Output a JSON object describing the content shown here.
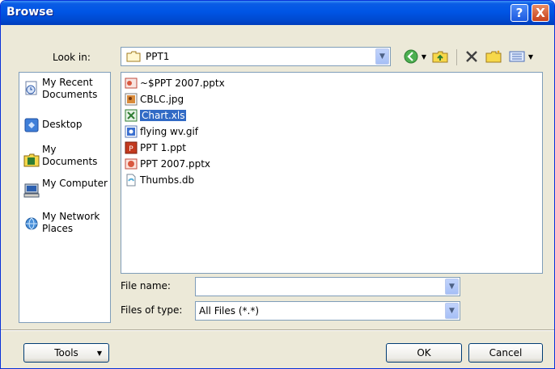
{
  "window": {
    "title": "Browse",
    "help_label": "?",
    "close_label": "X"
  },
  "look_in": {
    "label": "Look in:",
    "value": "PPT1"
  },
  "places": [
    {
      "label": "My Recent Documents",
      "icon": "recent-documents-icon"
    },
    {
      "label": "Desktop",
      "icon": "desktop-icon"
    },
    {
      "label": "My Documents",
      "icon": "my-documents-icon"
    },
    {
      "label": "My Computer",
      "icon": "my-computer-icon"
    },
    {
      "label": "My Network Places",
      "icon": "network-places-icon"
    }
  ],
  "files": [
    {
      "name": "~$PPT 2007.pptx",
      "icon": "pptx-file-icon",
      "selected": false
    },
    {
      "name": "CBLC.jpg",
      "icon": "image-file-icon",
      "selected": false
    },
    {
      "name": "Chart.xls",
      "icon": "excel-file-icon",
      "selected": true
    },
    {
      "name": "flying wv.gif",
      "icon": "gif-file-icon",
      "selected": false
    },
    {
      "name": "PPT 1.ppt",
      "icon": "ppt-file-icon",
      "selected": false
    },
    {
      "name": "PPT 2007.pptx",
      "icon": "pptx-file-icon",
      "selected": false
    },
    {
      "name": "Thumbs.db",
      "icon": "db-file-icon",
      "selected": false
    }
  ],
  "file_name": {
    "label": "File name:",
    "value": ""
  },
  "file_type": {
    "label": "Files of type:",
    "value": "All Files (*.*)"
  },
  "buttons": {
    "tools": "Tools",
    "ok": "OK",
    "cancel": "Cancel"
  },
  "colors": {
    "titlebar": "#0055e5",
    "dialog_bg": "#ece9d8",
    "selection": "#316ac5"
  }
}
